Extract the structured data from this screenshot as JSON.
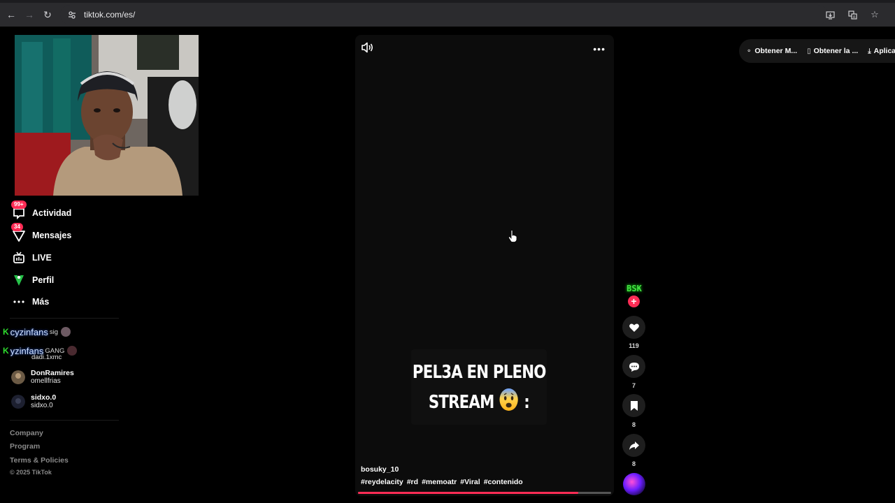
{
  "browser": {
    "url": "tiktok.com/es/",
    "icons": [
      "back-arrow-icon",
      "forward-arrow-icon",
      "reload-icon",
      "site-settings-icon",
      "install-app-icon",
      "translate-icon",
      "bookmark-star-icon"
    ]
  },
  "sidebar": {
    "items": [
      {
        "label": "Actividad",
        "badge": "99+",
        "icon": "inbox-icon"
      },
      {
        "label": "Mensajes",
        "badge": "34",
        "icon": "messages-icon"
      },
      {
        "label": "LIVE",
        "badge": "",
        "icon": "live-icon"
      },
      {
        "label": "Perfil",
        "badge": "",
        "icon": "profile-icon"
      },
      {
        "label": "Más",
        "badge": "",
        "icon": "more-dots-icon"
      }
    ],
    "overlay_lines": [
      {
        "prefix": "K",
        "text": "cyzinfans",
        "ghost": "sig"
      },
      {
        "prefix": "K",
        "text": "yzinfans",
        "ghost": "GANG"
      }
    ],
    "ghost_subtext": "dadi.1xmc",
    "accounts": [
      {
        "name": "DonRamires",
        "handle": "omellfrias"
      },
      {
        "name": "sidxo.0",
        "handle": "sidxo.0"
      }
    ],
    "footer_links": [
      "Company",
      "Program",
      "Terms & Policies"
    ],
    "copyright": "© 2025 TikTok"
  },
  "video": {
    "caption_line1": "PEL3A EN PLENO",
    "caption_line2": "STREAM",
    "caption_suffix": ":",
    "author": "bosuky_10",
    "hashtags": [
      "#reydelacity",
      "#rd",
      "#memoatr",
      "#Viral",
      "#contenido"
    ],
    "progress": 0.87
  },
  "actions": {
    "creator_tag": "BSK",
    "likes": "119",
    "comments": "7",
    "saves": "8",
    "shares": "8"
  },
  "get_bar": {
    "items": [
      {
        "label": "Obtener M...",
        "icon": "coin-icon"
      },
      {
        "label": "Obtener la ...",
        "icon": "phone-icon"
      },
      {
        "label": "Aplica",
        "icon": "download-icon"
      }
    ]
  },
  "colors": {
    "accent": "#fe2c55",
    "background": "#000000",
    "chrome": "#2b2b2e"
  }
}
